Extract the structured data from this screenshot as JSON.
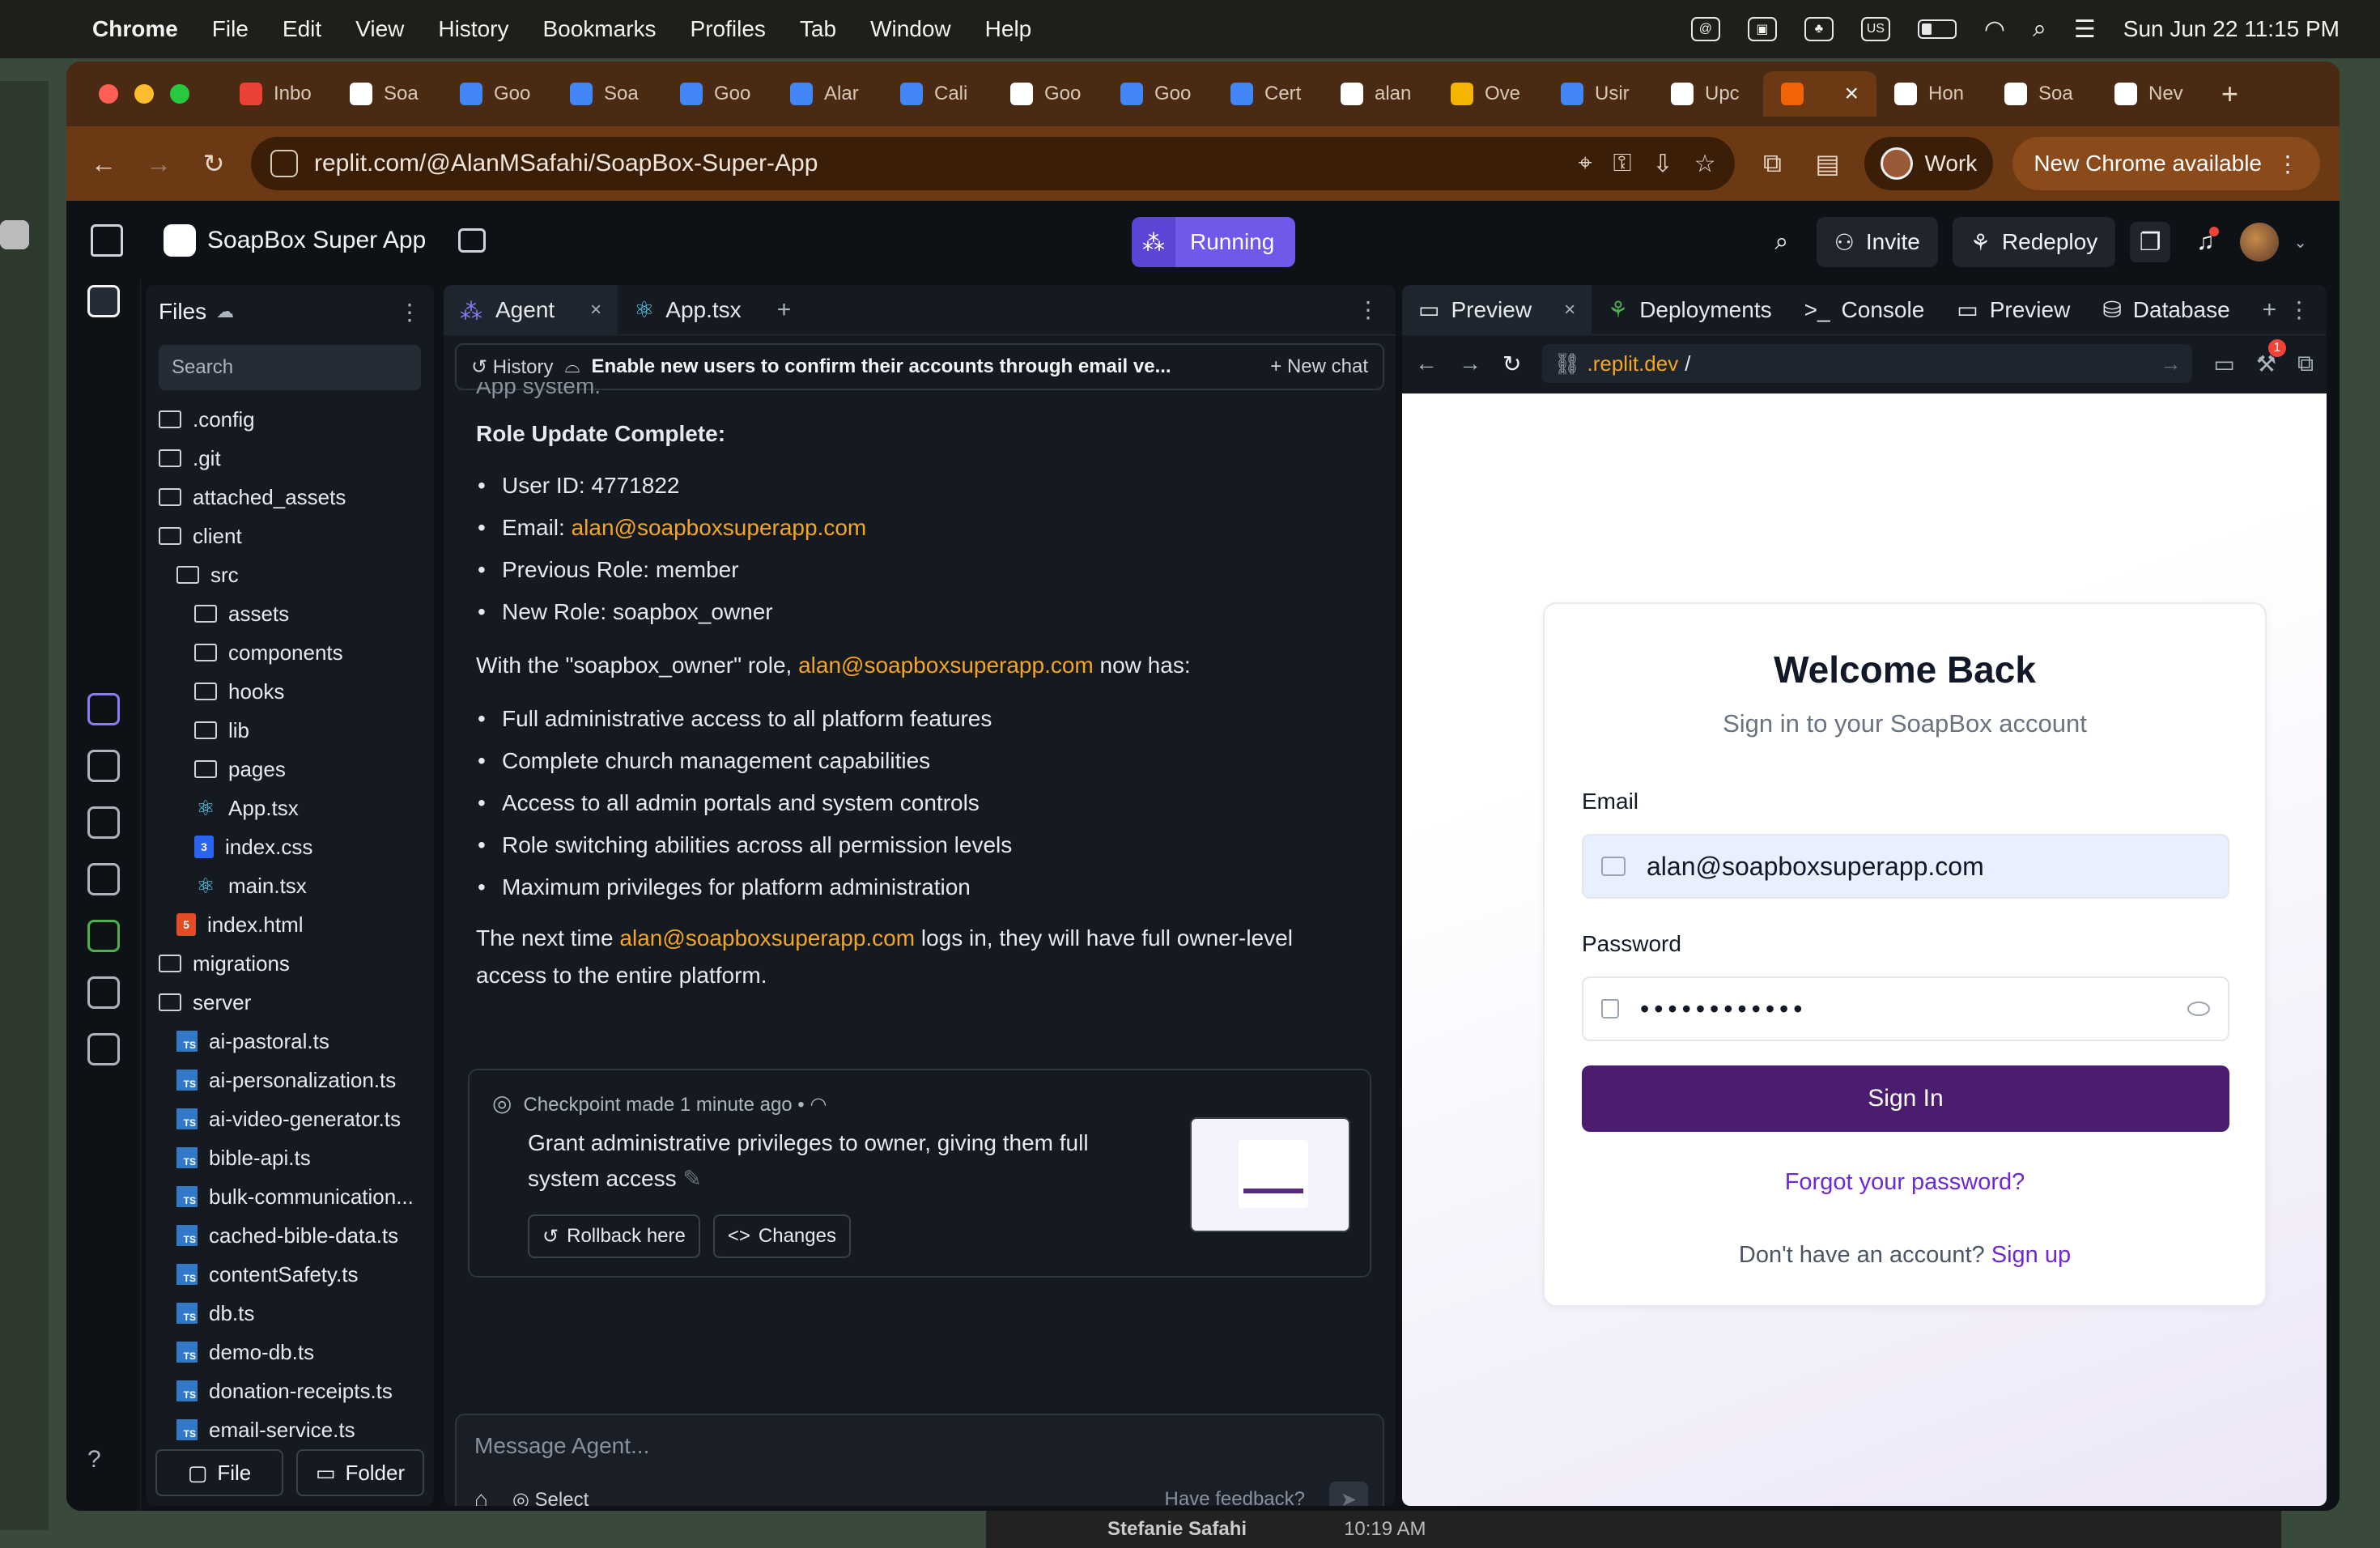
{
  "menubar": {
    "app": "Chrome",
    "items": [
      "File",
      "Edit",
      "View",
      "History",
      "Bookmarks",
      "Profiles",
      "Tab",
      "Window",
      "Help"
    ],
    "us_label": "US",
    "datetime": "Sun Jun 22  11:15 PM"
  },
  "browser": {
    "tabs": [
      {
        "label": "Inbo",
        "color": "#ea4335"
      },
      {
        "label": "Soa",
        "color": "#ffffff"
      },
      {
        "label": "Goo",
        "color": "#4285f4"
      },
      {
        "label": "Soa",
        "color": "#4285f4"
      },
      {
        "label": "Goo",
        "color": "#4285f4"
      },
      {
        "label": "Alar",
        "color": "#4285f4"
      },
      {
        "label": "Cali",
        "color": "#4285f4"
      },
      {
        "label": "Goo",
        "color": "#ffffff"
      },
      {
        "label": "Goo",
        "color": "#4285f4"
      },
      {
        "label": "Cert",
        "color": "#4285f4"
      },
      {
        "label": "alan",
        "color": "#ffffff"
      },
      {
        "label": "Ove",
        "color": "#f4b400"
      },
      {
        "label": "Usir",
        "color": "#4285f4"
      },
      {
        "label": "Upc",
        "color": "#ffffff"
      }
    ],
    "active_tab": {
      "label": "",
      "color": "#f26207"
    },
    "tabs_after": [
      {
        "label": "Hon",
        "color": "#ffffff"
      },
      {
        "label": "Soa",
        "color": "#ffffff"
      },
      {
        "label": "Nev",
        "color": "#ffffff"
      }
    ],
    "url": "replit.com/@AlanMSafahi/SoapBox-Super-App",
    "profile": "Work",
    "update": "New Chrome available"
  },
  "app": {
    "name": "SoapBox Super App",
    "run_label": "Running",
    "invite": "Invite",
    "redeploy": "Redeploy"
  },
  "files": {
    "title": "Files",
    "search_placeholder": "Search",
    "tree": [
      {
        "name": ".config",
        "type": "folder",
        "depth": 0
      },
      {
        "name": ".git",
        "type": "folder",
        "depth": 0
      },
      {
        "name": "attached_assets",
        "type": "folder",
        "depth": 0
      },
      {
        "name": "client",
        "type": "folder",
        "depth": 0
      },
      {
        "name": "src",
        "type": "folder",
        "depth": 1
      },
      {
        "name": "assets",
        "type": "folder",
        "depth": 2
      },
      {
        "name": "components",
        "type": "folder",
        "depth": 2
      },
      {
        "name": "hooks",
        "type": "folder",
        "depth": 2
      },
      {
        "name": "lib",
        "type": "folder",
        "depth": 2
      },
      {
        "name": "pages",
        "type": "folder",
        "depth": 2
      },
      {
        "name": "App.tsx",
        "type": "react",
        "depth": 2
      },
      {
        "name": "index.css",
        "type": "css",
        "depth": 2
      },
      {
        "name": "main.tsx",
        "type": "react",
        "depth": 2
      },
      {
        "name": "index.html",
        "type": "html",
        "depth": 1
      },
      {
        "name": "migrations",
        "type": "folder",
        "depth": 0
      },
      {
        "name": "server",
        "type": "folder",
        "depth": 0
      },
      {
        "name": "ai-pastoral.ts",
        "type": "ts",
        "depth": 1
      },
      {
        "name": "ai-personalization.ts",
        "type": "ts",
        "depth": 1
      },
      {
        "name": "ai-video-generator.ts",
        "type": "ts",
        "depth": 1
      },
      {
        "name": "bible-api.ts",
        "type": "ts",
        "depth": 1
      },
      {
        "name": "bulk-communication...",
        "type": "ts",
        "depth": 1
      },
      {
        "name": "cached-bible-data.ts",
        "type": "ts",
        "depth": 1
      },
      {
        "name": "contentSafety.ts",
        "type": "ts",
        "depth": 1
      },
      {
        "name": "db.ts",
        "type": "ts",
        "depth": 1
      },
      {
        "name": "demo-db.ts",
        "type": "ts",
        "depth": 1
      },
      {
        "name": "donation-receipts.ts",
        "type": "ts",
        "depth": 1
      },
      {
        "name": "email-service.ts",
        "type": "ts",
        "depth": 1
      }
    ],
    "add_file": "File",
    "add_folder": "Folder"
  },
  "agent": {
    "tab_agent": "Agent",
    "tab_file": "App.tsx",
    "history": "History",
    "chat_title": "Enable new users to confirm their accounts through email ve...",
    "new_chat": "New chat",
    "cut_text": "App system.",
    "heading": "Role Update Complete:",
    "details": [
      {
        "label": "User ID: ",
        "value": "4771822"
      },
      {
        "label": "Email: ",
        "value": "alan@soapboxsuperapp.com",
        "link": true
      },
      {
        "label": "Previous Role: ",
        "value": "member"
      },
      {
        "label": "New Role: ",
        "value": "soapbox_owner"
      }
    ],
    "p1_pre": "With the \"soapbox_owner\" role, ",
    "p1_link": "alan@soapboxsuperapp.com",
    "p1_post": " now has:",
    "privileges": [
      "Full administrative access to all platform features",
      "Complete church management capabilities",
      "Access to all admin portals and system controls",
      "Role switching abilities across all permission levels",
      "Maximum privileges for platform administration"
    ],
    "p2_pre": "The next time ",
    "p2_link": "alan@soapboxsuperapp.com",
    "p2_post": " logs in, they will have full owner-level access to the entire platform.",
    "checkpoint_meta": "Checkpoint made 1 minute ago",
    "checkpoint_desc": "Grant administrative privileges to owner, giving them full system access",
    "rollback": "Rollback here",
    "changes": "Changes",
    "composer_placeholder": "Message Agent...",
    "select": "Select",
    "feedback": "Have feedback?"
  },
  "preview": {
    "tabs": [
      "Preview",
      "Deployments",
      "Console",
      "Preview",
      "Database"
    ],
    "url_host": ".replit.dev",
    "url_path": "/",
    "devtools_badge": "1",
    "login": {
      "title": "Welcome Back",
      "subtitle": "Sign in to your SoapBox account",
      "email_label": "Email",
      "email_value": "alan@soapboxsuperapp.com",
      "password_label": "Password",
      "password_value": "••••••••••••",
      "signin": "Sign In",
      "forgot": "Forgot your password?",
      "signup_prefix": "Don't have an account? ",
      "signup_link": "Sign up"
    }
  },
  "background": {
    "name": "Stefanie Safahi",
    "time": "10:19 AM"
  }
}
